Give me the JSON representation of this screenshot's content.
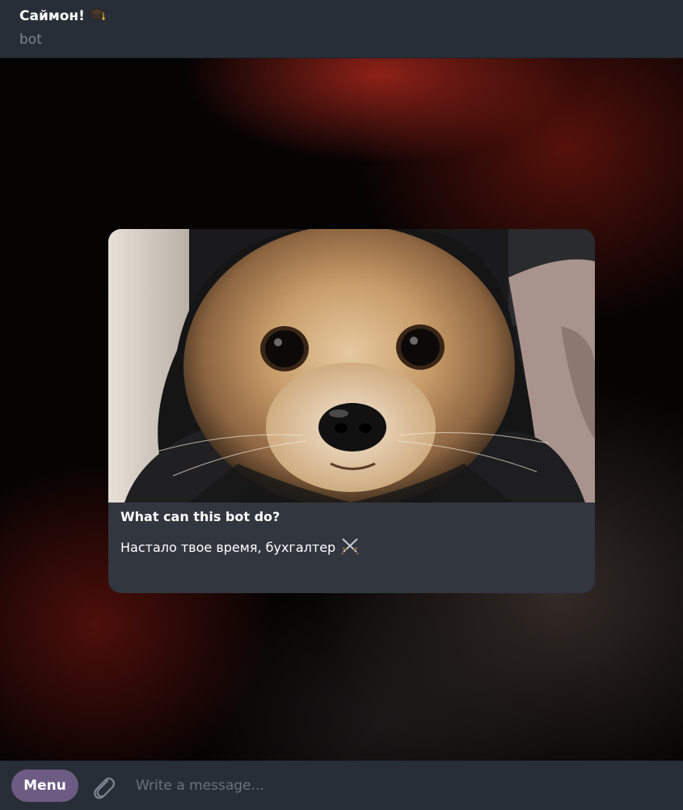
{
  "header": {
    "title": "Саймон!",
    "title_emoji": "graduation-cap-icon",
    "subtitle": "bot"
  },
  "card": {
    "image": "pomeranian-dog-in-black-hood-photo",
    "title": "What can this bot do?",
    "text": "Настало твое время, бухгалтер",
    "text_emoji": "crossed-swords-icon"
  },
  "composer": {
    "menu_label": "Menu",
    "attach_icon": "paperclip-icon",
    "input_placeholder": "Write a message...",
    "input_value": ""
  },
  "colors": {
    "header_bg": "#282e37",
    "card_bg": "#32363f",
    "menu_button_bg": "#6d5b83",
    "subtitle_text": "#7c8590",
    "placeholder_text": "#6a727d"
  }
}
